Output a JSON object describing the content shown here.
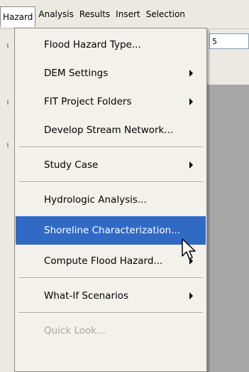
{
  "menubar": {
    "items": [
      {
        "label": "Hazard",
        "active": true
      },
      {
        "label": "Analysis"
      },
      {
        "label": "Results"
      },
      {
        "label": "Insert"
      },
      {
        "label": "Selection"
      }
    ]
  },
  "background_field_value": "5",
  "dropdown": {
    "items": [
      {
        "label": "Flood Hazard Type..."
      },
      {
        "label": "DEM Settings",
        "submenu": true
      },
      {
        "label": "FIT Project Folders",
        "submenu": true
      },
      {
        "label": "Develop Stream Network..."
      },
      {
        "label": "Study Case",
        "submenu": true
      },
      {
        "label": "Hydrologic Analysis..."
      },
      {
        "label": "Shoreline Characterization...",
        "highlighted": true
      },
      {
        "label": "Compute Flood Hazard...",
        "submenu": true
      },
      {
        "label": "What-If Scenarios",
        "submenu": true
      },
      {
        "label": "Quick Look...",
        "disabled": true
      }
    ]
  },
  "colors": {
    "highlight": "#316ac5",
    "menu_background": "#f2f1ec",
    "disabled_text": "#a9a79f"
  }
}
